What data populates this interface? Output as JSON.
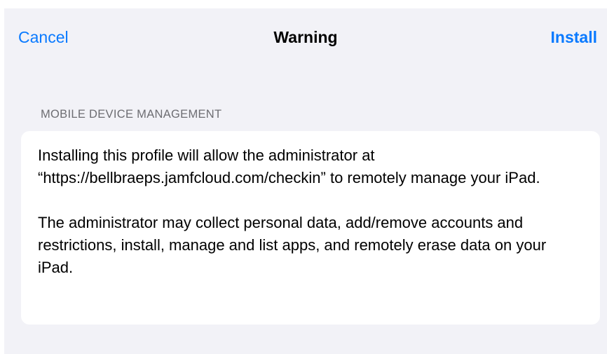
{
  "navbar": {
    "cancel_label": "Cancel",
    "title": "Warning",
    "install_label": "Install",
    "accent_color": "#0a7aff"
  },
  "section": {
    "header": "MOBILE DEVICE MANAGEMENT",
    "paragraphs": [
      "Installing this profile will allow the administrator at “https://bellbraeps.jamfcloud.com/checkin” to remotely manage your iPad.",
      "The administrator may collect personal data, add/remove accounts and restrictions, install, manage and list apps, and remotely erase data on your iPad."
    ]
  }
}
